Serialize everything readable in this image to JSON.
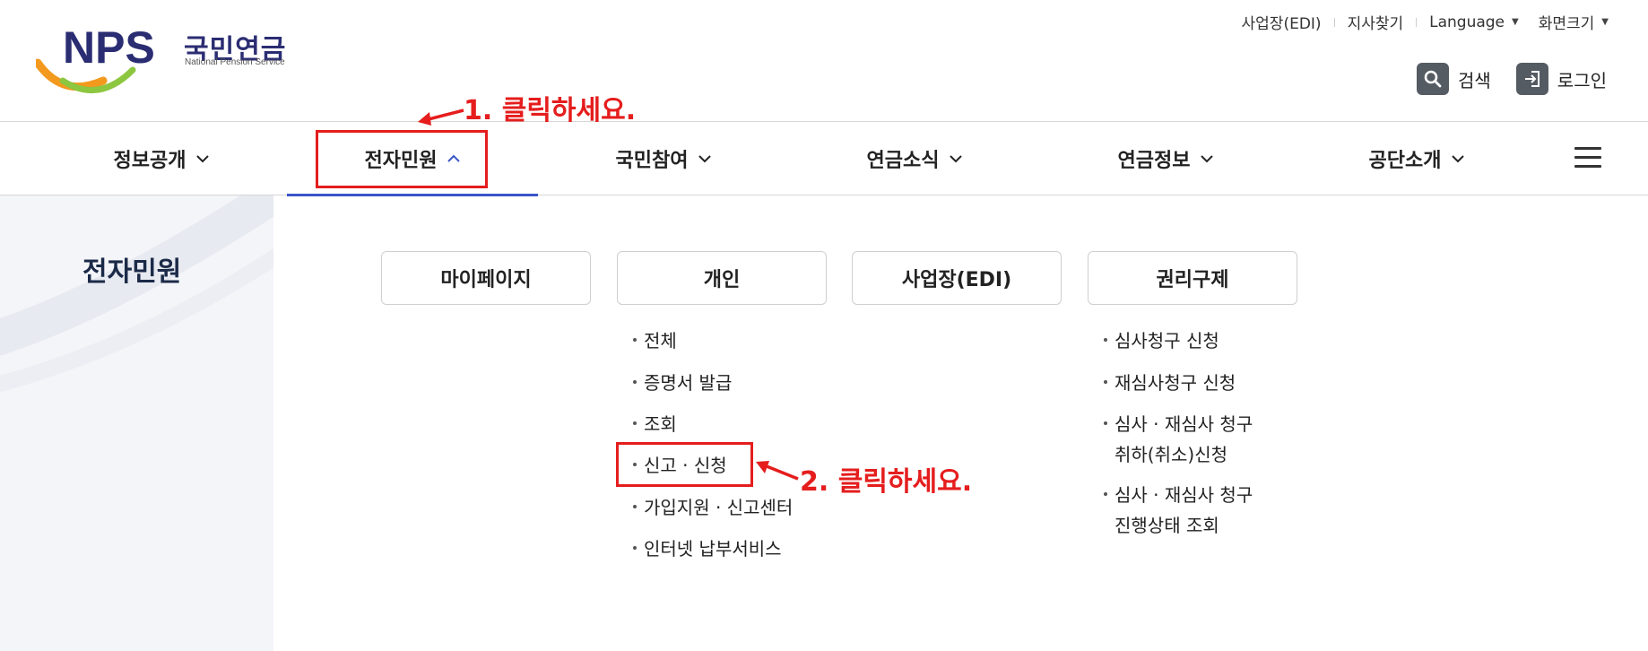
{
  "logo": {
    "abbr": "NPS",
    "name_ko": "국민연금",
    "name_en": "National Pension Service"
  },
  "utility_links": [
    {
      "label": "사업장(EDI)",
      "has_caret": false
    },
    {
      "label": "지사찾기",
      "has_caret": false
    },
    {
      "label": "Language",
      "has_caret": true
    },
    {
      "label": "화면크기",
      "has_caret": true
    }
  ],
  "actions": {
    "search_label": "검색",
    "login_label": "로그인"
  },
  "gnb": [
    {
      "label": "정보공개",
      "expanded": false
    },
    {
      "label": "전자민원",
      "expanded": true
    },
    {
      "label": "국민참여",
      "expanded": false
    },
    {
      "label": "연금소식",
      "expanded": false
    },
    {
      "label": "연금정보",
      "expanded": false
    },
    {
      "label": "공단소개",
      "expanded": false
    }
  ],
  "lnb": {
    "title": "전자민원"
  },
  "categories": [
    {
      "label": "마이페이지",
      "items": []
    },
    {
      "label": "개인",
      "items": [
        "전체",
        "증명서 발급",
        "조회",
        "신고 · 신청",
        "가입지원 · 신고센터",
        "인터넷 납부서비스"
      ]
    },
    {
      "label": "사업장(EDI)",
      "items": []
    },
    {
      "label": "권리구제",
      "items": [
        {
          "line1": "심사청구 신청"
        },
        {
          "line1": "재심사청구 신청"
        },
        {
          "line1": "심사 · 재심사 청구",
          "line2": "취하(취소)신청"
        },
        {
          "line1": "심사 · 재심사 청구",
          "line2": "진행상태 조회"
        }
      ]
    }
  ],
  "annotations": {
    "step1": "1. 클릭하세요.",
    "step2": "2. 클릭하세요.",
    "color": "#e51d1d"
  },
  "colors": {
    "brand_navy": "#2b2d73",
    "active_underline": "#3a55c7",
    "panel_bg": "#f4f5f9"
  }
}
